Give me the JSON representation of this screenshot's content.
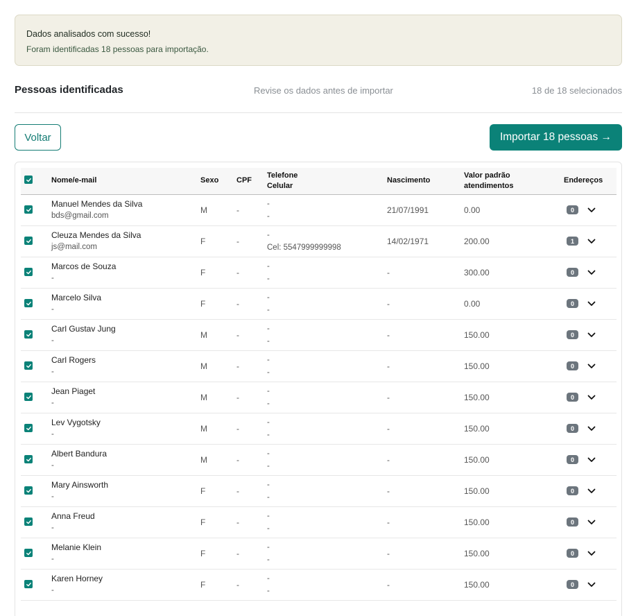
{
  "alert": {
    "line1": "Dados analisados com sucesso!",
    "line2": "Foram identificadas 18 pessoas para importação."
  },
  "header": {
    "title": "Pessoas identificadas",
    "subtitle": "Revise os dados antes de importar",
    "count": "18 de 18 selecionados"
  },
  "actions": {
    "back_label": "Voltar",
    "import_label": "Importar 18 pessoas →"
  },
  "colors": {
    "accent": "#0b8278",
    "badge": "#6c757d"
  },
  "table": {
    "columns": {
      "name": "Nome/e-mail",
      "sex": "Sexo",
      "cpf": "CPF",
      "phone": "Telefone",
      "cell": "Celular",
      "birth": "Nascimento",
      "value1": "Valor padrão",
      "value2": "atendimentos",
      "addresses": "Endereços"
    },
    "rows": [
      {
        "name": "Manuel Mendes da Silva",
        "email": "bds@gmail.com",
        "sex": "M",
        "cpf": "-",
        "phone": "-",
        "cell": "-",
        "birth": "21/07/1991",
        "value": "0.00",
        "addr": "0",
        "checked": true
      },
      {
        "name": "Cleuza Mendes da Silva",
        "email": "js@mail.com",
        "sex": "F",
        "cpf": "-",
        "phone": "-",
        "cell": "Cel: 5547999999998",
        "birth": "14/02/1971",
        "value": "200.00",
        "addr": "1",
        "checked": true
      },
      {
        "name": "Marcos de Souza",
        "email": "-",
        "sex": "F",
        "cpf": "-",
        "phone": "-",
        "cell": "-",
        "birth": "-",
        "value": "300.00",
        "addr": "0",
        "checked": true
      },
      {
        "name": "Marcelo Silva",
        "email": "-",
        "sex": "F",
        "cpf": "-",
        "phone": "-",
        "cell": "-",
        "birth": "-",
        "value": "0.00",
        "addr": "0",
        "checked": true
      },
      {
        "name": "Carl Gustav Jung",
        "email": "-",
        "sex": "M",
        "cpf": "-",
        "phone": "-",
        "cell": "-",
        "birth": "-",
        "value": "150.00",
        "addr": "0",
        "checked": true
      },
      {
        "name": "Carl Rogers",
        "email": "-",
        "sex": "M",
        "cpf": "-",
        "phone": "-",
        "cell": "-",
        "birth": "-",
        "value": "150.00",
        "addr": "0",
        "checked": true
      },
      {
        "name": "Jean Piaget",
        "email": "-",
        "sex": "M",
        "cpf": "-",
        "phone": "-",
        "cell": "-",
        "birth": "-",
        "value": "150.00",
        "addr": "0",
        "checked": true
      },
      {
        "name": "Lev Vygotsky",
        "email": "-",
        "sex": "M",
        "cpf": "-",
        "phone": "-",
        "cell": "-",
        "birth": "-",
        "value": "150.00",
        "addr": "0",
        "checked": true
      },
      {
        "name": "Albert Bandura",
        "email": "-",
        "sex": "M",
        "cpf": "-",
        "phone": "-",
        "cell": "-",
        "birth": "-",
        "value": "150.00",
        "addr": "0",
        "checked": true
      },
      {
        "name": "Mary Ainsworth",
        "email": "-",
        "sex": "F",
        "cpf": "-",
        "phone": "-",
        "cell": "-",
        "birth": "-",
        "value": "150.00",
        "addr": "0",
        "checked": true
      },
      {
        "name": "Anna Freud",
        "email": "-",
        "sex": "F",
        "cpf": "-",
        "phone": "-",
        "cell": "-",
        "birth": "-",
        "value": "150.00",
        "addr": "0",
        "checked": true
      },
      {
        "name": "Melanie Klein",
        "email": "-",
        "sex": "F",
        "cpf": "-",
        "phone": "-",
        "cell": "-",
        "birth": "-",
        "value": "150.00",
        "addr": "0",
        "checked": true
      },
      {
        "name": "Karen Horney",
        "email": "-",
        "sex": "F",
        "cpf": "-",
        "phone": "-",
        "cell": "-",
        "birth": "-",
        "value": "150.00",
        "addr": "0",
        "checked": true
      }
    ]
  }
}
